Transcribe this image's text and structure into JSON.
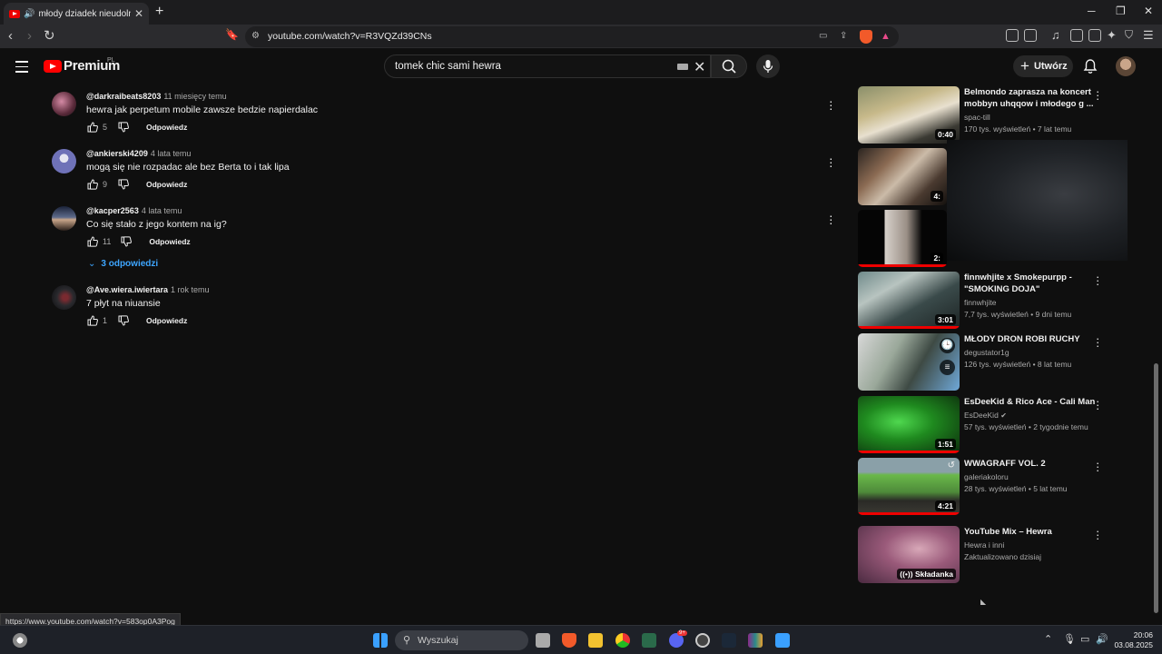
{
  "browser": {
    "tab_title": "młody dziadek nieudolnie tłu",
    "url": "youtube.com/watch?v=R3VQZd39CNs",
    "status_url": "https://www.youtube.com/watch?v=583op0A3Pog"
  },
  "header": {
    "brand": "Premium",
    "brand_region": "PL",
    "search_query": "tomek chic sami hewra",
    "create_label": "Utwórz"
  },
  "comments": [
    {
      "author": "@darkraibeats8203",
      "time": "11 miesięcy temu",
      "text": "hewra jak perpetum mobile zawsze bedzie napierdalac",
      "likes": "5",
      "reply": "Odpowiedz"
    },
    {
      "author": "@ankierski4209",
      "time": "4 lata temu",
      "text": "mogą się nie rozpadac ale bez Berta to i tak lipa",
      "likes": "9",
      "reply": "Odpowiedz"
    },
    {
      "author": "@kacper2563",
      "time": "4 lata temu",
      "text": "Co się stało z jego kontem na ig?",
      "likes": "11",
      "reply": "Odpowiedz"
    },
    {
      "author": "@Ave.wiera.iwiertara",
      "time": "1 rok temu",
      "text": "7 płyt na niuansie",
      "likes": "1",
      "reply": "Odpowiedz"
    }
  ],
  "replies_toggle": "3 odpowiedzi",
  "videos": [
    {
      "title": "Belmondo zaprasza na koncert mobbyn uhqqow i młodego g ...",
      "channel": "spac-till",
      "meta": "170 tys. wyświetleń • 7 lat temu",
      "duration": "0:40"
    },
    {
      "title": "",
      "channel": "",
      "meta": "",
      "duration": "4:"
    },
    {
      "title": "",
      "channel": "",
      "meta": "",
      "duration": "2:"
    },
    {
      "title": "finnwhjite x Smokepurpp - \"SMOKING DOJA\"",
      "channel": "finnwhjite",
      "meta": "7,7 tys. wyświetleń • 9 dni temu",
      "duration": "3:01"
    },
    {
      "title": "MŁODY DRON ROBI RUCHY",
      "channel": "degustator1g",
      "meta": "126 tys. wyświetleń • 8 lat temu",
      "duration": ""
    },
    {
      "title": "EsDeeKid & Rico Ace - Cali Man",
      "channel": "EsDeeKid",
      "meta": "57 tys. wyświetleń • 2 tygodnie temu",
      "duration": "1:51"
    },
    {
      "title": "WWAGRAFF VOL. 2",
      "channel": "galeriakoloru",
      "meta": "28 tys. wyświetleń • 5 lat temu",
      "duration": "4:21"
    },
    {
      "title": "YouTube Mix – Hewra",
      "channel": "Hewra i inni",
      "meta": "Zaktualizowano dzisiaj",
      "duration": "Składanka"
    }
  ],
  "taskbar": {
    "search_placeholder": "Wyszukaj",
    "time": "20:06",
    "date": "03.08.2025",
    "discord_badge": "9+"
  }
}
